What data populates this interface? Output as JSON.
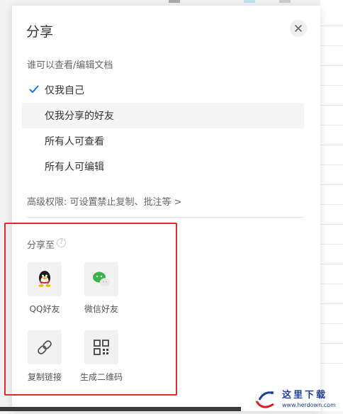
{
  "dialog": {
    "title": "分享",
    "close_icon": "close-icon"
  },
  "permissions": {
    "section_label": "谁可以查看/编辑文档",
    "options": [
      {
        "label": "仅我自己",
        "selected": true
      },
      {
        "label": "仅我分享的好友",
        "selected": false
      },
      {
        "label": "所有人可查看",
        "selected": false
      },
      {
        "label": "所有人可编辑",
        "selected": false
      }
    ],
    "advanced_label": "高级权限: 可设置禁止复制、批注等 >"
  },
  "share": {
    "section_label": "分享至",
    "targets": [
      {
        "label": "QQ好友",
        "icon": "qq-icon"
      },
      {
        "label": "微信好友",
        "icon": "wechat-icon"
      },
      {
        "label": "复制链接",
        "icon": "link-icon"
      },
      {
        "label": "生成二维码",
        "icon": "qrcode-icon"
      }
    ]
  },
  "colors": {
    "highlight_border": "#e32a2a",
    "check_mark": "#1a73e8",
    "wechat_green": "#3bb54a"
  },
  "watermark": {
    "text": "这里下载",
    "url": "www.herdown.com"
  }
}
